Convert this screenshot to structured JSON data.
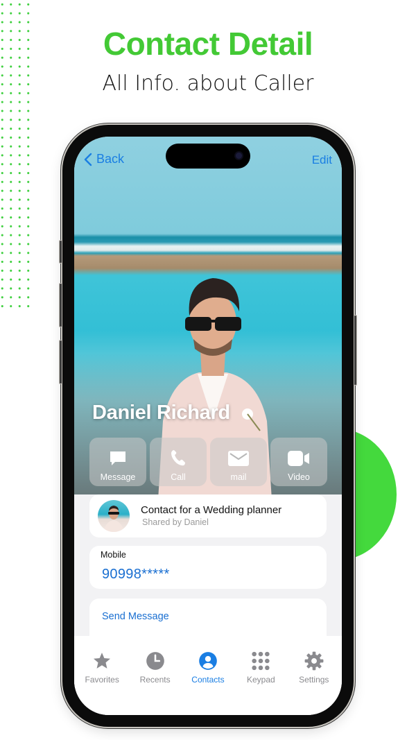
{
  "promo": {
    "title": "Contact Detail",
    "subtitle": "All Info. about Caller",
    "accent_color": "#43c935"
  },
  "nav": {
    "back_label": "Back",
    "edit_label": "Edit"
  },
  "contact": {
    "name": "Daniel Richard"
  },
  "actions": [
    {
      "id": "message",
      "label": "Message",
      "icon": "message-bubble-icon"
    },
    {
      "id": "call",
      "label": "Call",
      "icon": "phone-icon"
    },
    {
      "id": "mail",
      "label": "mail",
      "icon": "envelope-icon"
    },
    {
      "id": "video",
      "label": "Video",
      "icon": "video-camera-icon"
    }
  ],
  "shared_card": {
    "title": "Contact for a Wedding planner",
    "subtitle": "Shared by Daniel"
  },
  "mobile": {
    "label": "Mobile",
    "value": "90998*****"
  },
  "send_message_label": "Send Message",
  "tabbar": {
    "active": "Contacts",
    "items": [
      {
        "label": "Favorites",
        "icon": "star-icon"
      },
      {
        "label": "Recents",
        "icon": "clock-icon"
      },
      {
        "label": "Contacts",
        "icon": "person-circle-icon"
      },
      {
        "label": "Keypad",
        "icon": "keypad-icon"
      },
      {
        "label": "Settings",
        "icon": "gear-icon"
      }
    ],
    "active_color": "#1a7ee3",
    "inactive_color": "#8a8a8e"
  }
}
